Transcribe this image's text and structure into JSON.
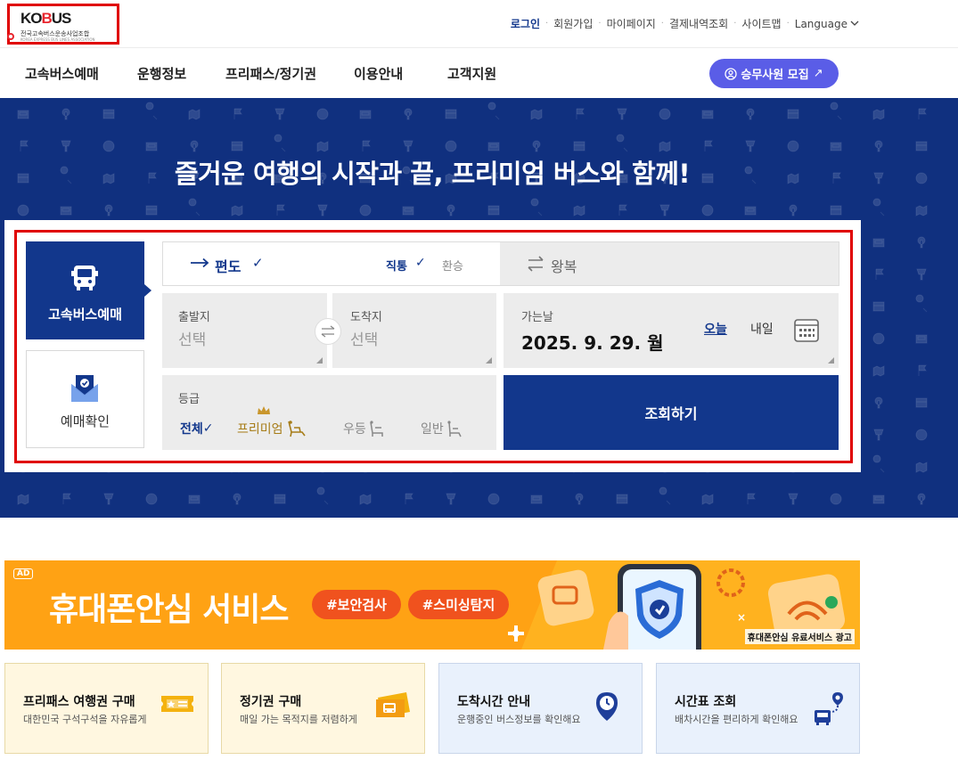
{
  "logo": {
    "brand_left": "KO",
    "brand_accent": "B",
    "brand_right": "US",
    "subtitle": "전국고속버스운송사업조합",
    "subtitle_en": "KOREA EXPRESS BUS LINES ASSOCIATION"
  },
  "util_nav": {
    "login": "로그인",
    "signup": "회원가입",
    "mypage": "마이페이지",
    "payments": "결제내역조회",
    "sitemap": "사이트맵",
    "language": "Language"
  },
  "gnb": {
    "items": [
      "고속버스예매",
      "운행정보",
      "프리패스/정기권",
      "이용안내",
      "고객지원"
    ],
    "recruit": "승무사원 모집",
    "recruit_arrow": "↗"
  },
  "hero": {
    "title": "즐거운 여행의 시작과 끝, 프리미엄 버스와 함께!"
  },
  "booking": {
    "tab_reserve": "고속버스예매",
    "tab_confirm": "예매확인",
    "oneway": "편도",
    "oneway_check": "✓",
    "direct": "직통",
    "direct_check": "✓",
    "transfer": "환승",
    "roundtrip": "왕복",
    "depart_caption": "출발지",
    "depart_value": "선택",
    "arrive_caption": "도착지",
    "arrive_value": "선택",
    "date_caption": "가는날",
    "date_value": "2025. 9. 29. 월",
    "today": "오늘",
    "tomorrow": "내일",
    "grade_caption": "등급",
    "grades": [
      "전체",
      "프리미엄",
      "우등",
      "일반"
    ],
    "grade_check": "✓",
    "search": "조회하기"
  },
  "ad": {
    "badge": "AD",
    "title": "휴대폰안심 서비스",
    "tags": [
      "#보안검사",
      "#스미싱탐지"
    ],
    "note": "휴대폰안심 유료서비스 광고"
  },
  "cards": [
    {
      "title": "프리패스 여행권 구매",
      "desc": "대한민국 구석구석을 자유롭게",
      "icon": "ticket-icon"
    },
    {
      "title": "정기권 구매",
      "desc": "매일 가는 목적지를 저렴하게",
      "icon": "bus-ticket-icon"
    },
    {
      "title": "도착시간 안내",
      "desc": "운행중인 버스정보를 확인해요",
      "icon": "clock-pin-icon"
    },
    {
      "title": "시간표 조회",
      "desc": "배차시간을 편리하게 확인해요",
      "icon": "route-bus-icon"
    }
  ],
  "colors": {
    "primary": "#12378c",
    "hero_bg": "#10307f",
    "accent_purple": "#5a5de7",
    "ad_orange": "#ffa214",
    "highlight_red": "#e00000"
  }
}
